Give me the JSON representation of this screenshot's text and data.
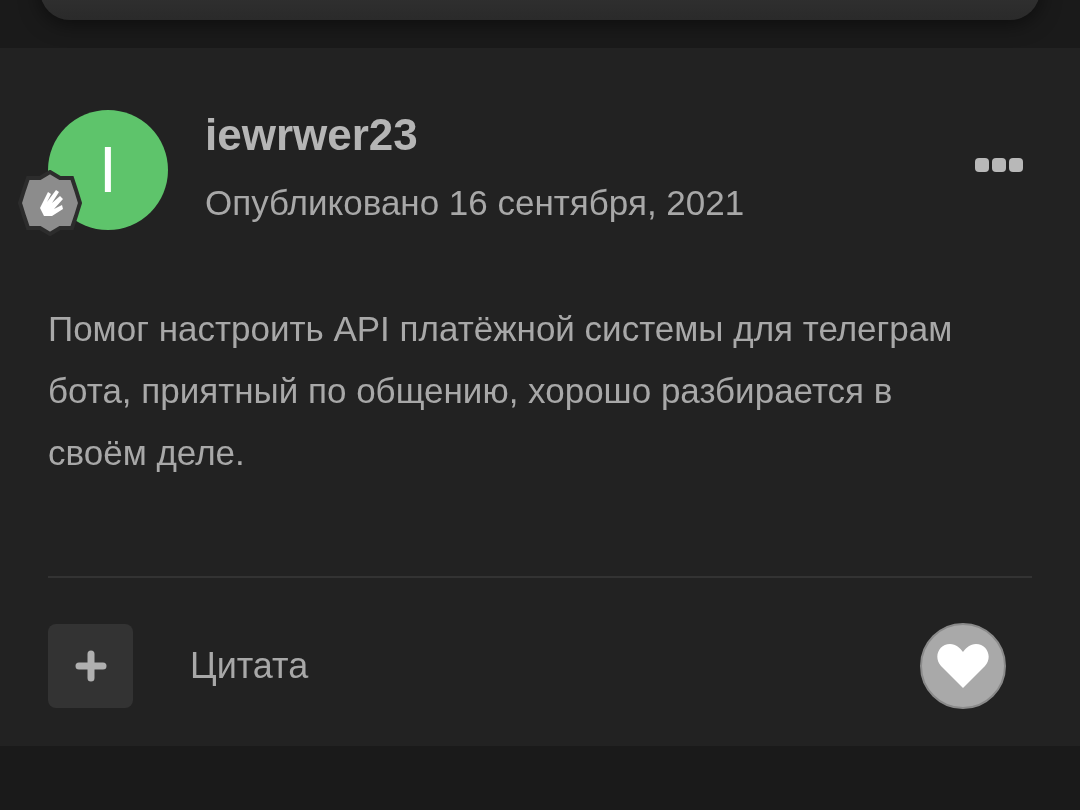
{
  "post": {
    "author": {
      "name": "iewrwer23",
      "initial": "I"
    },
    "date": "Опубликовано 16 сентября, 2021",
    "body": "Помог настроить API платёжной системы для телеграм бота, приятный по общению, хорошо разбирается в своём деле.",
    "quote_label": "Цитата"
  }
}
